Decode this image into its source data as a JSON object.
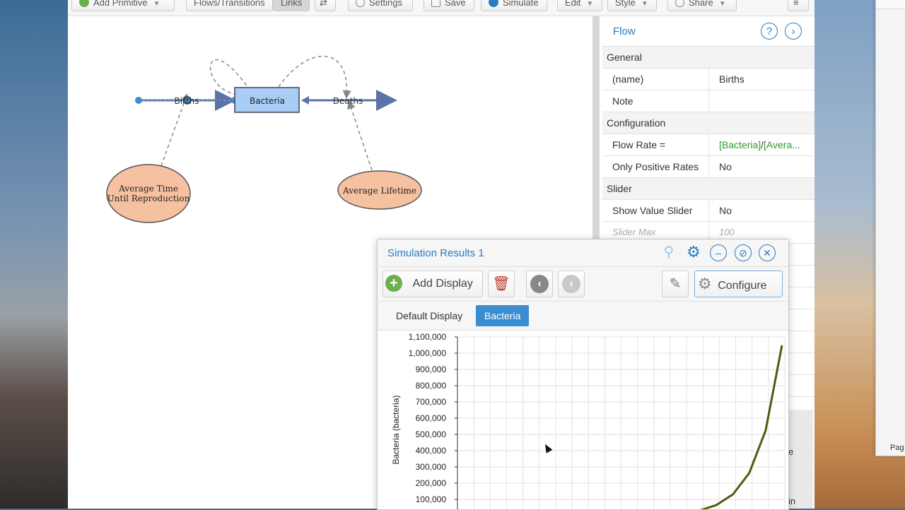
{
  "toolbar": {
    "add_primitive": "Add Primitive",
    "flows_transitions": "Flows/Transitions",
    "links": "Links",
    "settings": "Settings",
    "save": "Save",
    "simulate": "Simulate",
    "edit": "Edit",
    "style": "Style",
    "share": "Share"
  },
  "diagram": {
    "stock": "Bacteria",
    "flow_in": "Births",
    "flow_out": "Deaths",
    "var1_line1": "Average Time",
    "var1_line2": "Until Reproduction",
    "var2": "Average Lifetime"
  },
  "props": {
    "title": "Flow",
    "help_icon": "?",
    "sections": {
      "general": "General",
      "configuration": "Configuration",
      "slider": "Slider"
    },
    "rows": {
      "name": {
        "key": "(name)",
        "value": "Births"
      },
      "note": {
        "key": "Note",
        "value": ""
      },
      "flow_rate": {
        "key": "Flow Rate =",
        "value_a": "[Bacteria]",
        "value_sep": "/",
        "value_b": "[Avera..."
      },
      "only_positive": {
        "key": "Only Positive Rates",
        "value": "No"
      },
      "show_slider": {
        "key": "Show Value Slider",
        "value": "No"
      },
      "slider_max": {
        "key": "Slider Max",
        "value": "100"
      }
    }
  },
  "sim": {
    "title": "Simulation Results 1",
    "add_display": "Add Display",
    "configure": "Configure",
    "tabs": [
      "Default Display",
      "Bacteria"
    ]
  },
  "side_stub": {
    "line1": "e",
    "line2": "in"
  },
  "right_window": {
    "label": "Pag"
  },
  "chart_data": {
    "type": "line",
    "ylabel": "Bacteria (bacteria)",
    "y_ticks": [
      "1,100,000",
      "1,000,000",
      "900,000",
      "800,000",
      "700,000",
      "600,000",
      "500,000",
      "400,000",
      "300,000",
      "200,000",
      "100,000"
    ],
    "ylim": [
      0,
      1100000
    ],
    "x": [
      0,
      1,
      2,
      3,
      4,
      5,
      6,
      7,
      8,
      9,
      10,
      11,
      12,
      13,
      14,
      15,
      16,
      17,
      18,
      19,
      20
    ],
    "series": [
      {
        "values": [
          1,
          2,
          4,
          8,
          16,
          32,
          64,
          128,
          256,
          512,
          1024,
          2048,
          4096,
          8192,
          16384,
          32768,
          65536,
          131072,
          262144,
          524288,
          1048576
        ]
      }
    ],
    "line_color": "#4a5e0f",
    "grid": true
  }
}
